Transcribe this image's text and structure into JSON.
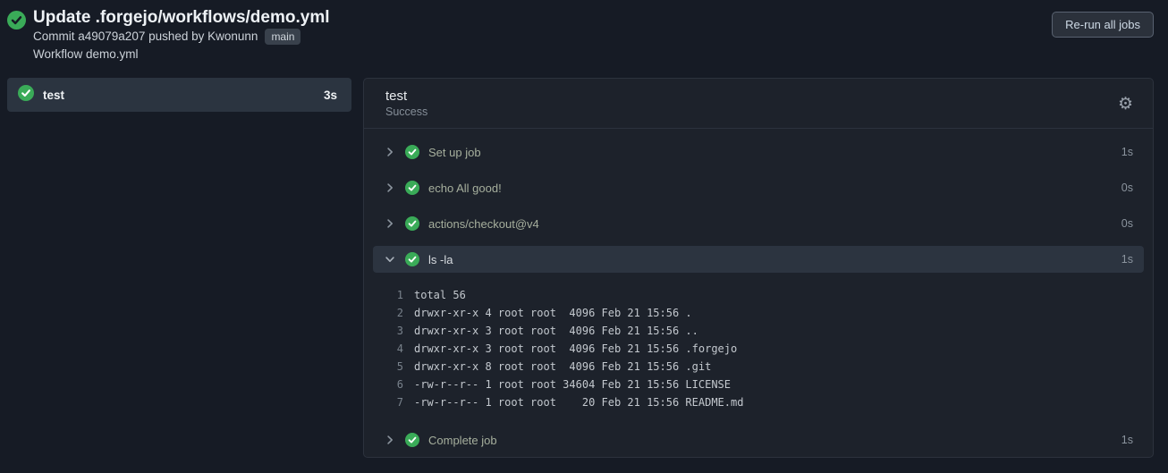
{
  "colors": {
    "success_green": "#3aab58",
    "page_background": "#161b25",
    "panel_background": "#1d222b",
    "highlight_row": "#2c3440"
  },
  "icons": {
    "status_success": "check-circle",
    "gear": "⚙",
    "chevron_right": "❯",
    "chevron_down": "⌄"
  },
  "header": {
    "title": "Update .forgejo/workflows/demo.yml",
    "commit_line": "Commit a49079a207 pushed by Kwonunn",
    "branch": "main",
    "workflow_line": "Workflow demo.yml",
    "rerun_button": "Re-run all jobs"
  },
  "sidebar": {
    "jobs": [
      {
        "name": "test",
        "duration": "3s",
        "status": "success",
        "selected": true
      }
    ]
  },
  "main": {
    "job_name": "test",
    "job_status": "Success",
    "steps": [
      {
        "name": "Set up job",
        "duration": "1s",
        "status": "success",
        "expanded": false
      },
      {
        "name": "echo All good!",
        "duration": "0s",
        "status": "success",
        "expanded": false
      },
      {
        "name": "actions/checkout@v4",
        "duration": "0s",
        "status": "success",
        "expanded": false
      },
      {
        "name": "ls -la",
        "duration": "1s",
        "status": "success",
        "expanded": true,
        "logs": [
          "total 56",
          "drwxr-xr-x 4 root root  4096 Feb 21 15:56 .",
          "drwxr-xr-x 3 root root  4096 Feb 21 15:56 ..",
          "drwxr-xr-x 3 root root  4096 Feb 21 15:56 .forgejo",
          "drwxr-xr-x 8 root root  4096 Feb 21 15:56 .git",
          "-rw-r--r-- 1 root root 34604 Feb 21 15:56 LICENSE",
          "-rw-r--r-- 1 root root    20 Feb 21 15:56 README.md"
        ]
      },
      {
        "name": "Complete job",
        "duration": "1s",
        "status": "success",
        "expanded": false
      }
    ]
  }
}
